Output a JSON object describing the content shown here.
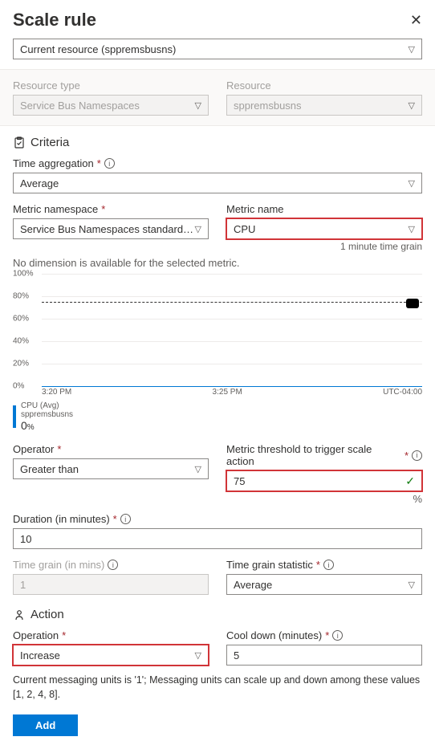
{
  "header": {
    "title": "Scale rule"
  },
  "resource_selector": {
    "display": "Current resource (sppremsbusns)"
  },
  "resource_band": {
    "type_label": "Resource type",
    "type_value": "Service Bus Namespaces",
    "resource_label": "Resource",
    "resource_value": "sppremsbusns"
  },
  "criteria": {
    "heading": "Criteria",
    "time_agg_label": "Time aggregation",
    "time_agg_value": "Average",
    "metric_ns_label": "Metric namespace",
    "metric_ns_value": "Service Bus Namespaces standard me...",
    "metric_name_label": "Metric name",
    "metric_name_value": "CPU",
    "grain_note": "1 minute time grain",
    "dimension_note": "No dimension is available for the selected metric.",
    "operator_label": "Operator",
    "operator_value": "Greater than",
    "threshold_label": "Metric threshold to trigger scale action",
    "threshold_value": "75",
    "threshold_unit": "%",
    "duration_label": "Duration (in minutes)",
    "duration_value": "10",
    "grain_mins_label": "Time grain (in mins)",
    "grain_mins_value": "1",
    "grain_stat_label": "Time grain statistic",
    "grain_stat_value": "Average"
  },
  "chart_data": {
    "type": "line",
    "ylim": [
      0,
      100
    ],
    "y_ticks": [
      "0%",
      "20%",
      "40%",
      "60%",
      "80%",
      "100%"
    ],
    "x_ticks": [
      "3:20 PM",
      "3:25 PM"
    ],
    "timezone": "UTC-04:00",
    "threshold": 75,
    "series": [
      {
        "name": "CPU (Avg)",
        "resource": "sppremsbusns",
        "current": 0,
        "unit": "%",
        "values_flat_at": 0
      }
    ]
  },
  "action": {
    "heading": "Action",
    "operation_label": "Operation",
    "operation_value": "Increase",
    "cooldown_label": "Cool down (minutes)",
    "cooldown_value": "5",
    "note": "Current messaging units is '1'; Messaging units can scale up and down among these values [1, 2, 4, 8]."
  },
  "buttons": {
    "add": "Add"
  }
}
